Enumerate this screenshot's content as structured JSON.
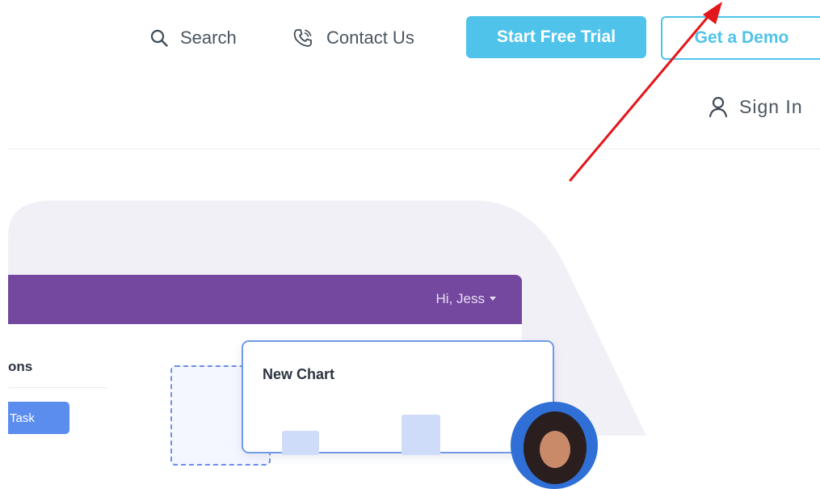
{
  "nav": {
    "search_label": "Search",
    "contact_label": "Contact Us",
    "trial_button": "Start Free Trial",
    "demo_button": "Get a Demo",
    "signin_label": "Sign In"
  },
  "app_preview": {
    "greeting": "Hi, Jess",
    "sidebar_heading": "ons",
    "task_button": "Task",
    "chart_title": "New Chart"
  },
  "colors": {
    "accent": "#4fc3ea",
    "app_header": "#74489e",
    "annotation_arrow": "#e3161b"
  },
  "icons": [
    "search-icon",
    "phone-icon",
    "user-icon",
    "caret-down-icon"
  ]
}
